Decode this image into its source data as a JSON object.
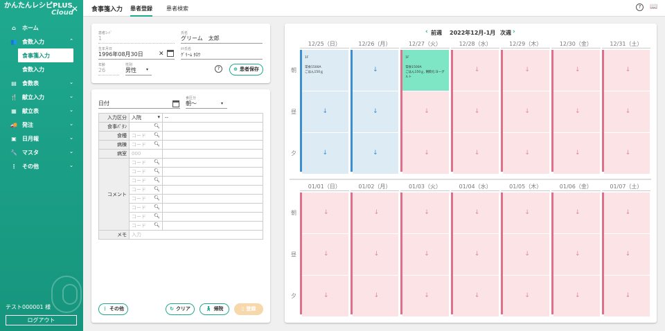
{
  "sidebar": {
    "brand": "かんたんレシピPLUS",
    "brand_sub": "Cloud",
    "items": [
      {
        "icon": "⌂",
        "label": "ホーム",
        "chevron": ""
      },
      {
        "icon": "👥",
        "label": "食数入力",
        "chevron": "⌃"
      },
      {
        "icon": "▤",
        "label": "食数表",
        "chevron": "⌄"
      },
      {
        "icon": "🍴",
        "label": "献立入力",
        "chevron": "⌄"
      },
      {
        "icon": "▦",
        "label": "献立表",
        "chevron": "⌄"
      },
      {
        "icon": "🚚",
        "label": "発注",
        "chevron": "⌄"
      },
      {
        "icon": "▣",
        "label": "日月報",
        "chevron": "⌄"
      },
      {
        "icon": "🔧",
        "label": "マスタ",
        "chevron": "⌄"
      },
      {
        "icon": "⋮",
        "label": "その他",
        "chevron": "⌄"
      }
    ],
    "sub_active": "食事箋入力",
    "sub_item": "食数入力",
    "user": "テスト000001 様",
    "logout": "ログアウト"
  },
  "topbar": {
    "title": "食事箋入力",
    "tab1": "患者登録",
    "tab2": "患者検索"
  },
  "patient": {
    "id_label": "患者ｺｰﾄﾞ",
    "id": "1",
    "name_label": "氏名",
    "name": "グリーム　太郎",
    "birth_label": "生年月日",
    "birth": "1996年08月30日",
    "kana_label": "ｶﾅ氏名",
    "kana": "ｸﾞﾘｰﾑ ﾀﾛｳ",
    "age_label": "年齢",
    "age": "26",
    "sex_label": "性別",
    "sex": "男性",
    "save": "患者保存"
  },
  "form": {
    "date_label": "日付",
    "meal_label": "食区分",
    "meal": "朝～",
    "rows": {
      "input": "入力区分",
      "input_val": "入院",
      "input_extra": "--",
      "pattern": "食事ﾊﾟﾀﾝ",
      "type": "食種",
      "ward": "病棟",
      "room": "病室",
      "room_ph": "000",
      "comment": "コメント",
      "memo": "メモ",
      "memo_ph": "入力",
      "code_ph": "コード"
    },
    "btn_other": "その他",
    "btn_clear": "クリア",
    "btn_discharge": "帰院",
    "btn_register": "登録"
  },
  "calendar": {
    "prev": "前週",
    "range": "2022年12月-1月",
    "next": "次週",
    "week1": [
      "12/25（日）",
      "12/26（月）",
      "12/27（火）",
      "12/28（水）",
      "12/29（木）",
      "12/30（金）",
      "12/31（土）"
    ],
    "week2": [
      "01/01（日）",
      "01/02（月）",
      "01/03（火）",
      "01/04（水）",
      "01/05（木）",
      "01/06（金）",
      "01/07（土）"
    ],
    "meals": [
      "朝",
      "昼",
      "夕"
    ],
    "note_day0": [
      "1F",
      "",
      "常食1500A",
      "ごはん150ｇ"
    ],
    "note_day2": [
      "1F",
      "",
      "常食1500A",
      "ごはん150ｇ, 朝飲むヨーグ",
      "ルト"
    ],
    "arrow": "↓"
  },
  "colors": {
    "accent": "#1fa98f",
    "pink": "#fbe3e6",
    "blue": "#dcebf4",
    "green": "#7ee6c4"
  }
}
